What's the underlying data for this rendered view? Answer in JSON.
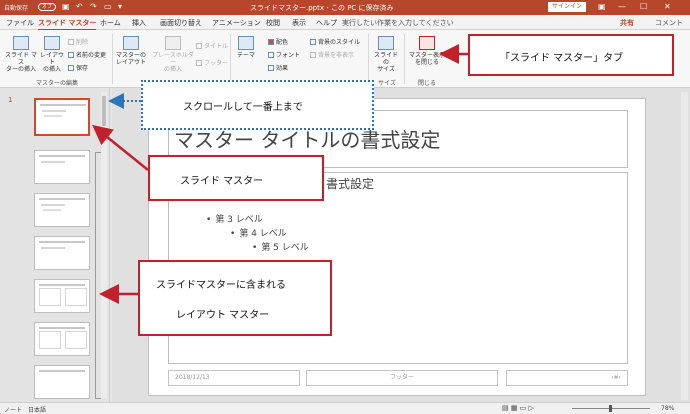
{
  "titlebar": {
    "autosave": "自動保存",
    "autosave_state": "オフ",
    "doc_title": "スライドマスター.pptx - この PC に保存済み",
    "signin": "サインイン"
  },
  "tabs": [
    "ファイル",
    "スライド マスター",
    "ホーム",
    "挿入",
    "画面切り替え",
    "アニメーション",
    "校閲",
    "表示",
    "ヘルプ"
  ],
  "tell_me": "実行したい作業を入力してください",
  "share": "共有",
  "comments": "コメント",
  "ribbon": {
    "insert_master": [
      "スライド マス",
      "ターの挿入"
    ],
    "insert_layout": [
      "レイアウト",
      "の挿入"
    ],
    "delete": "削除",
    "rename": "名前の変更",
    "preserve": "保存",
    "group_edit_master": "マスターの編集",
    "master_layout": [
      "マスターの",
      "レイアウト"
    ],
    "insert_placeholder": [
      "プレースホルダー",
      "の挿入"
    ],
    "title_check": "タイトル",
    "footer_check": "フッター",
    "themes": "テーマ",
    "colors": "配色",
    "fonts": "フォント",
    "effects": "効果",
    "bg_styles": "背景のスタイル",
    "hide_bg": "背景を非表示",
    "slide_size": [
      "スライドの",
      "サイズ"
    ],
    "group_size": "サイズ",
    "close_master": [
      "マスター表示",
      "を閉じる"
    ],
    "group_close": "閉じる"
  },
  "slide_number": "1",
  "slide": {
    "title": "マスター タイトルの書式設定",
    "level1": "書式設定",
    "level3": "第 3 レベル",
    "level4": "第 4 レベル",
    "level5": "第 5 レベル",
    "date": "2018/12/13",
    "footer": "フッター",
    "page_num": "‹#›"
  },
  "status": {
    "notes": "ノート",
    "language": "日本語",
    "zoom": "78%",
    "zoom_fraction": 0.49
  },
  "callouts": {
    "tab": "「スライド マスター」タブ",
    "scroll": "スクロールして一番上まで",
    "master": "スライド マスター",
    "layouts_1": "スライドマスターに含まれる",
    "layouts_2": "レイアウト マスター"
  },
  "colors": {
    "accent": "#b7472a",
    "callout_border": "#c0212a",
    "dotted_border": "#2e74b5"
  }
}
